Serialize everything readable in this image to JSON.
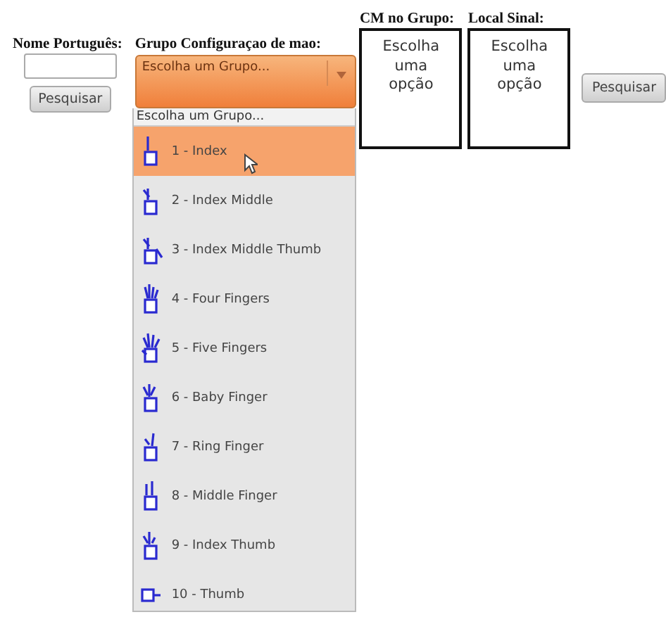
{
  "search_name": {
    "label": "Nome Português:",
    "button": "Pesquisar"
  },
  "group": {
    "label": "Grupo Configuraçao de mao:",
    "value": "Escolha um Grupo...",
    "expanded": true,
    "options_header": "Escolha um Grupo...",
    "options": [
      {
        "label": "1 - Index",
        "selected": true
      },
      {
        "label": "2 - Index Middle",
        "selected": false
      },
      {
        "label": "3 - Index Middle Thumb",
        "selected": false
      },
      {
        "label": "4 - Four Fingers",
        "selected": false
      },
      {
        "label": "5 - Five Fingers",
        "selected": false
      },
      {
        "label": "6 - Baby Finger",
        "selected": false
      },
      {
        "label": "7 - Ring Finger",
        "selected": false
      },
      {
        "label": "8 - Middle Finger",
        "selected": false
      },
      {
        "label": "9 - Index Thumb",
        "selected": false
      },
      {
        "label": "10 - Thumb",
        "selected": false
      }
    ]
  },
  "cm_group": {
    "label": "CM no Grupo:",
    "text": "Escolha uma opção"
  },
  "local_sinal": {
    "label": "Local Sinal:",
    "text": "Escolha uma opção"
  },
  "search_button": "Pesquisar"
}
